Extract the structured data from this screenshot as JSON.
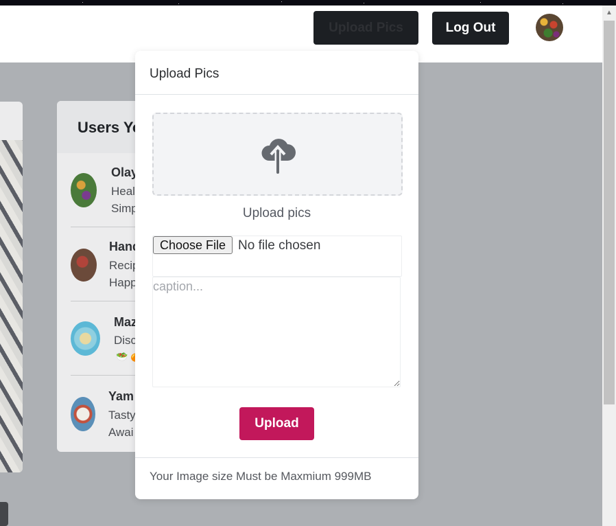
{
  "header": {
    "upload_button_label": "Upload Pics",
    "logout_button_label": "Log Out"
  },
  "users_card": {
    "title": "Users Yo",
    "users": [
      {
        "name": "Olay",
        "line1": "Heal",
        "line2": "Simp"
      },
      {
        "name": "Hand",
        "line1": "Recip",
        "line2": "Happ"
      },
      {
        "name": "Maz",
        "line1": "Disco",
        "line2": "🥗 🍊"
      },
      {
        "name": "Yam",
        "line1": "Tasty",
        "line2": "Awai"
      }
    ]
  },
  "modal": {
    "title": "Upload Pics",
    "dropzone_label": "Upload pics",
    "file_button_label": "Choose File",
    "file_status": "No file chosen",
    "caption_placeholder": "caption...",
    "submit_label": "Upload",
    "footer_note": "Your Image size Must be Maxmium 999MB"
  },
  "colors": {
    "accent": "#c2185b",
    "dark_button": "#1c1f23",
    "backdrop": "#adb0b4"
  },
  "icons": {
    "dropzone": "cloud-upload-icon",
    "avatar": "user-avatar"
  }
}
